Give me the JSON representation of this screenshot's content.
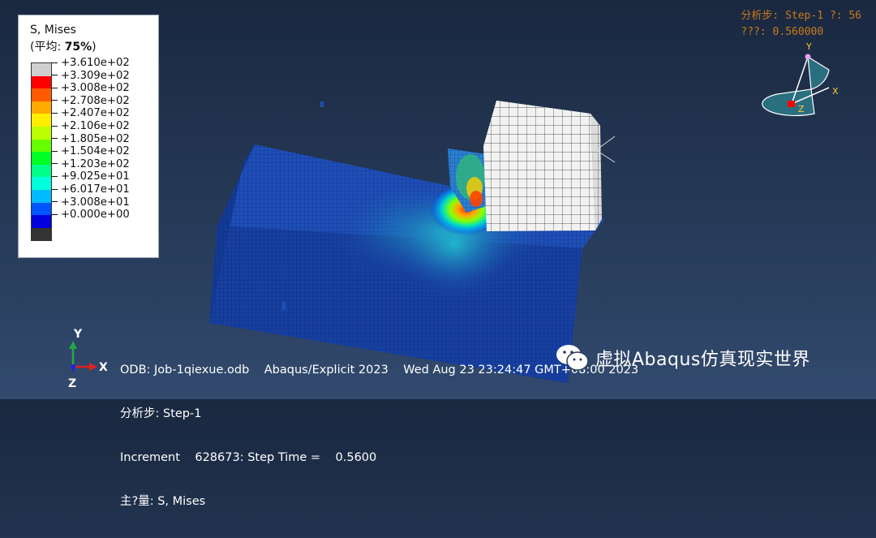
{
  "legend": {
    "title": "S, Mises",
    "avg_prefix": "(平均: ",
    "avg_value": "75%",
    "avg_suffix": ")",
    "entries": [
      {
        "label": "+3.610e+02",
        "color": "#cfcfcf"
      },
      {
        "label": "+3.309e+02",
        "color": "#ff0000"
      },
      {
        "label": "+3.008e+02",
        "color": "#ff5a00"
      },
      {
        "label": "+2.708e+02",
        "color": "#ffaa00"
      },
      {
        "label": "+2.407e+02",
        "color": "#ffee00"
      },
      {
        "label": "+2.106e+02",
        "color": "#bbff00"
      },
      {
        "label": "+1.805e+02",
        "color": "#66ff00"
      },
      {
        "label": "+1.504e+02",
        "color": "#00ff22"
      },
      {
        "label": "+1.203e+02",
        "color": "#00ff88"
      },
      {
        "label": "+9.025e+01",
        "color": "#00ffdd"
      },
      {
        "label": "+6.017e+01",
        "color": "#00bbff"
      },
      {
        "label": "+3.008e+01",
        "color": "#0055ff"
      },
      {
        "label": "+0.000e+00",
        "color": "#0000dd"
      }
    ],
    "bottom_color": "#333333"
  },
  "step_info": {
    "line1": "分析步: Step-1   ?: 56",
    "line2": "???: 0.560000"
  },
  "triad": {
    "y_label": "Y",
    "x_label": "X",
    "z_label": "Z"
  },
  "bottom_triad": {
    "y_label": "Y",
    "x_label": "X",
    "z_label": "Z"
  },
  "info": {
    "odb_line": "ODB: Job-1qiexue.odb    Abaqus/Explicit 2023    Wed Aug 23 23:24:47 GMT+08:00 2023",
    "step_line": "分析步: Step-1",
    "increment_line": "Increment    628673: Step Time =    0.5600",
    "variable_line": "主?量: S, Mises"
  },
  "watermark": {
    "text": "虚拟Abaqus仿真现实世界"
  },
  "colors": {
    "workpiece": "#1a3fa8",
    "tool": "#f2f2f2",
    "accent_text": "#c87a18"
  }
}
